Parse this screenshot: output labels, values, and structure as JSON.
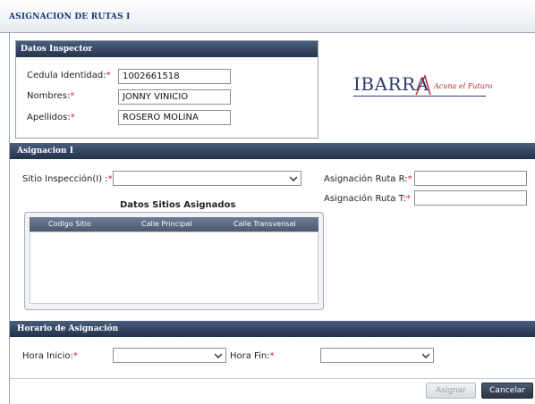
{
  "window": {
    "title": "ASIGNACION DE RUTAS I"
  },
  "inspector": {
    "header": "Datos Inspector",
    "cedula_label": "Cedula Identidad:",
    "cedula_value": "1002661518",
    "nombres_label": "Nombres:",
    "nombres_value": "JONNY VINICIO",
    "apellidos_label": "Apellidos:",
    "apellidos_value": "ROSERO MOLINA",
    "required_mark": "*"
  },
  "logo": {
    "name": "IBARRA",
    "tagline": "Acuna el Futuro"
  },
  "asignacion": {
    "header": "Asignacion I",
    "sitio_label": "Sitio Inspección(I) :",
    "sitio_value": "",
    "ruta_r_label": "Asignación Ruta R:",
    "ruta_r_value": "",
    "ruta_t_label": "Asignación Ruta T:",
    "ruta_t_value": "",
    "grid_title": "Datos Sitios Asignados",
    "grid_columns": [
      "Codigo Sitio",
      "Calle Principal",
      "Calle Transvensal"
    ]
  },
  "horario": {
    "header": "Horario de Asignación",
    "inicio_label": "Hora Inicio:",
    "inicio_value": "",
    "fin_label": "Hora Fin:",
    "fin_value": ""
  },
  "actions": {
    "asignar_label": "Asignar",
    "cancelar_label": "Cancelar"
  },
  "colors": {
    "header_dark": "#23324d",
    "required": "#e02020",
    "title_text": "#123a73"
  },
  "icons": {
    "dropdown": "chevron-down-icon"
  }
}
